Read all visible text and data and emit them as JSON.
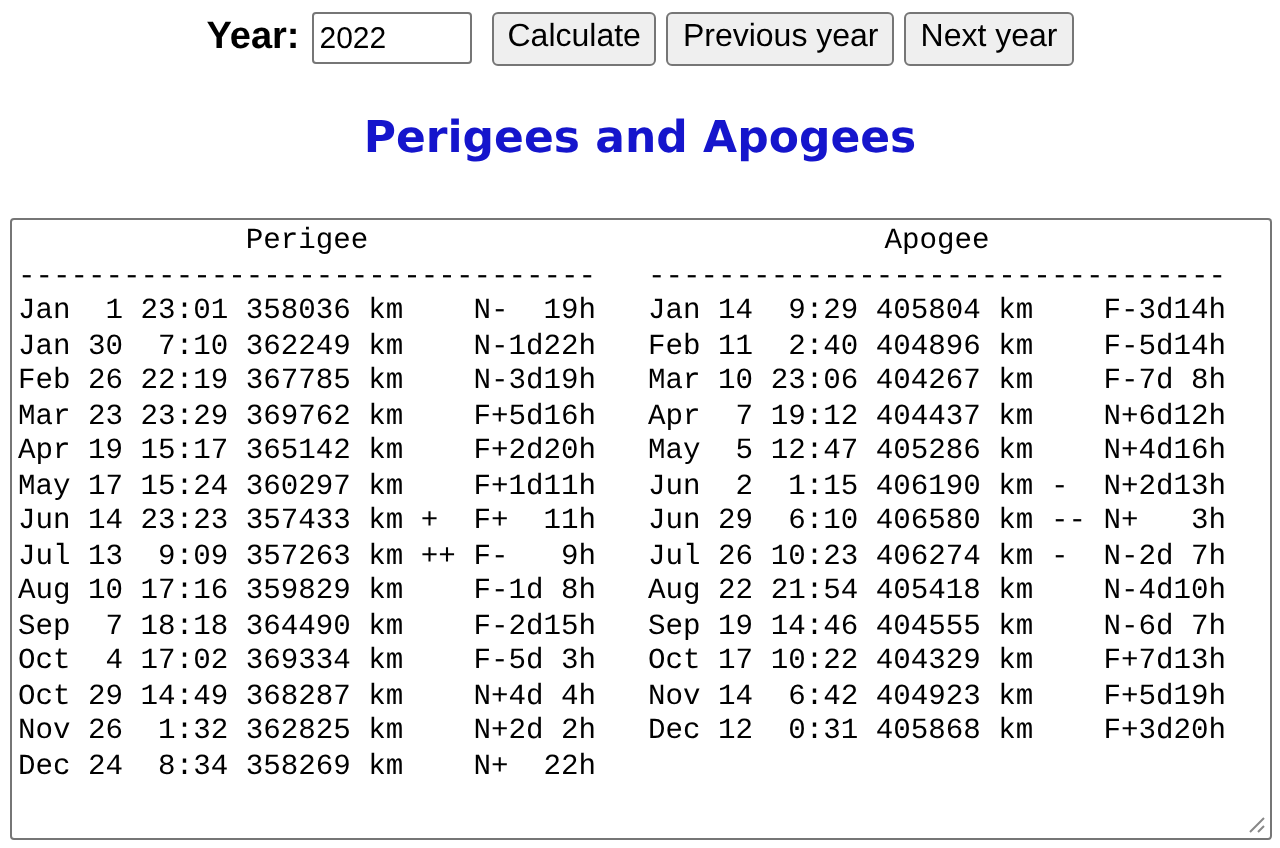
{
  "controls": {
    "year_label": "Year:",
    "year_input": {
      "value": "2022"
    },
    "buttons": [
      "Calculate",
      "Previous year",
      "Next year"
    ]
  },
  "title": "Perigees and Apogees",
  "output": {
    "columns": [
      {
        "heading": "Perigee",
        "rule": "---------------------------------",
        "rows": [
          "Jan  1 23:01 358036 km    N-  19h",
          "Jan 30  7:10 362249 km    N-1d22h",
          "Feb 26 22:19 367785 km    N-3d19h",
          "Mar 23 23:29 369762 km    F+5d16h",
          "Apr 19 15:17 365142 km    F+2d20h",
          "May 17 15:24 360297 km    F+1d11h",
          "Jun 14 23:23 357433 km +  F+  11h",
          "Jul 13  9:09 357263 km ++ F-   9h",
          "Aug 10 17:16 359829 km    F-1d 8h",
          "Sep  7 18:18 364490 km    F-2d15h",
          "Oct  4 17:02 369334 km    F-5d 3h",
          "Oct 29 14:49 368287 km    N+4d 4h",
          "Nov 26  1:32 362825 km    N+2d 2h",
          "Dec 24  8:34 358269 km    N+  22h"
        ]
      },
      {
        "heading": "Apogee",
        "rule": "---------------------------------",
        "rows": [
          "Jan 14  9:29 405804 km    F-3d14h",
          "Feb 11  2:40 404896 km    F-5d14h",
          "Mar 10 23:06 404267 km    F-7d 8h",
          "Apr  7 19:12 404437 km    N+6d12h",
          "May  5 12:47 405286 km    N+4d16h",
          "Jun  2  1:15 406190 km -  N+2d13h",
          "Jun 29  6:10 406580 km -- N+   3h",
          "Jul 26 10:23 406274 km -  N-2d 7h",
          "Aug 22 21:54 405418 km    N-4d10h",
          "Sep 19 14:46 404555 km    N-6d 7h",
          "Oct 17 10:22 404329 km    F+7d13h",
          "Nov 14  6:42 404923 km    F+5d19h",
          "Dec 12  0:31 405868 km    F+3d20h"
        ]
      }
    ]
  }
}
